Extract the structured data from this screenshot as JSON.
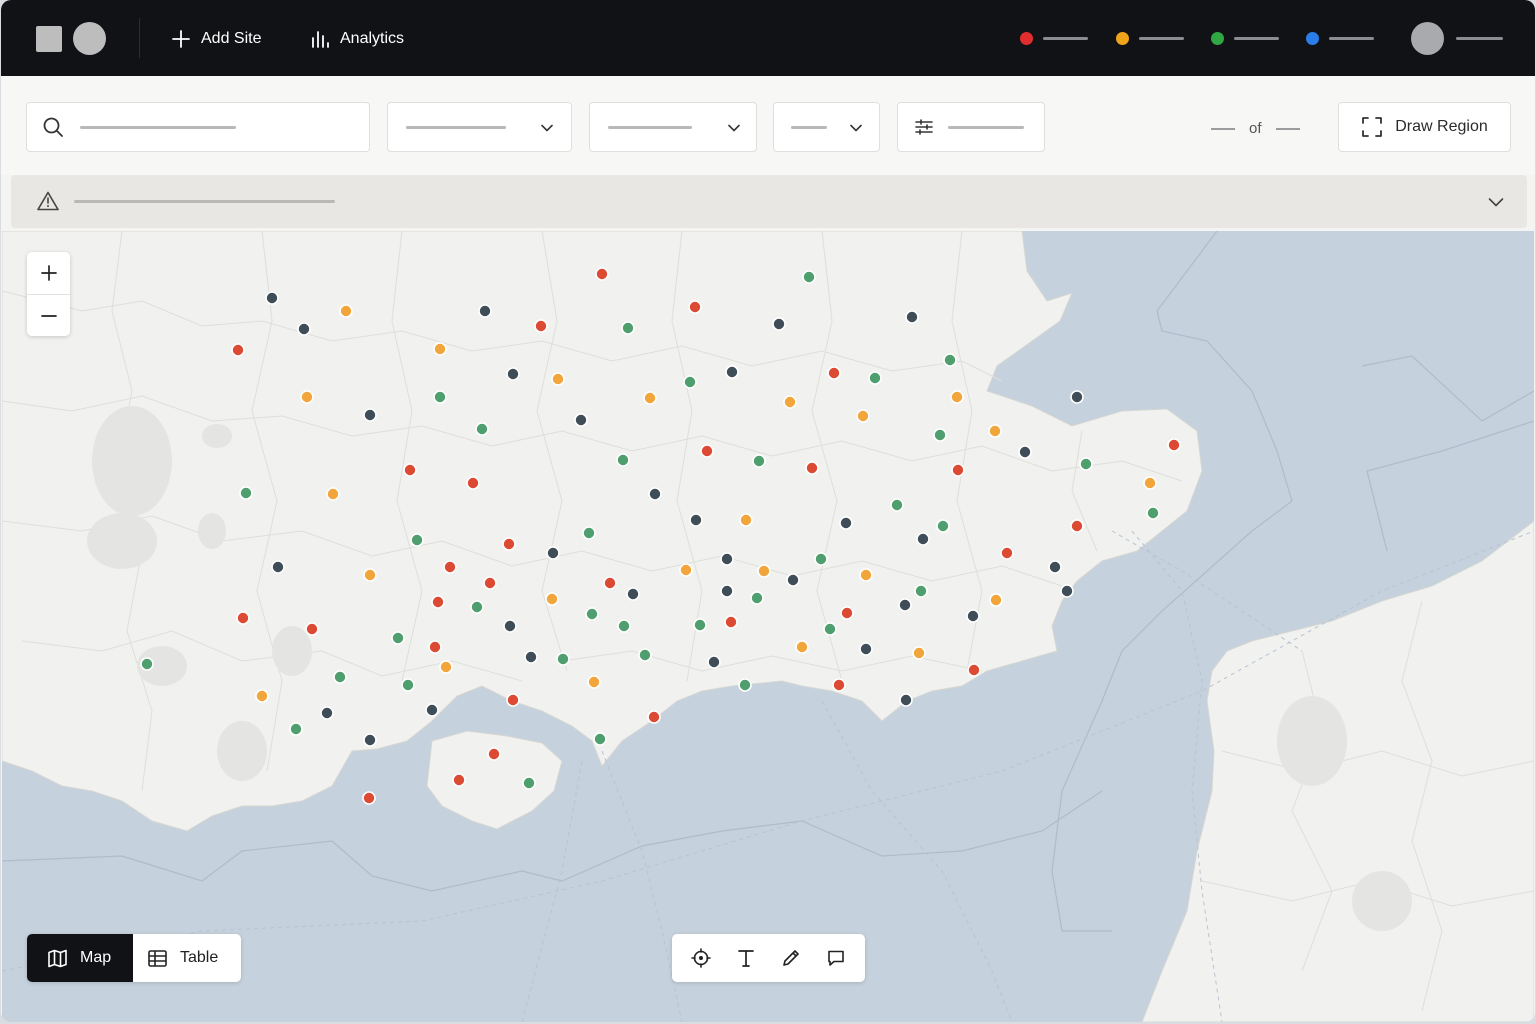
{
  "header": {
    "add_site_label": "Add Site",
    "analytics_label": "Analytics",
    "legend_colors": [
      "#e02d2d",
      "#f0a419",
      "#2fa844",
      "#2a7ee8"
    ]
  },
  "toolbar": {
    "pager_of": "of",
    "draw_region_label": "Draw Region"
  },
  "map": {
    "marker_colors": {
      "red": "#dd4a33",
      "orange": "#f2a53a",
      "green": "#4f9e6e",
      "slate": "#3e4d57",
      "land": "#f1f1ef",
      "water": "#c5d1dc"
    }
  },
  "view_toggle": {
    "map_label": "Map",
    "table_label": "Table",
    "active": "Map"
  },
  "tools": [
    "locate-icon",
    "text-tool-icon",
    "pencil-icon",
    "comment-icon"
  ]
}
